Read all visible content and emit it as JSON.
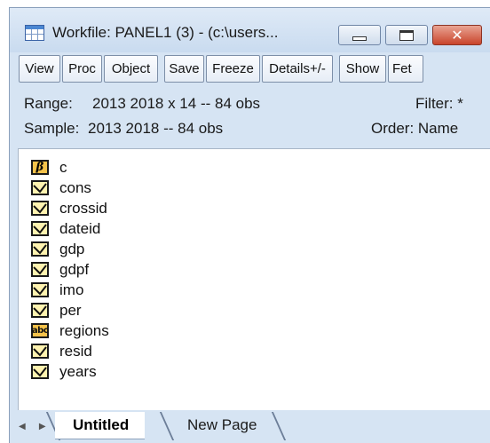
{
  "window": {
    "title": "Workfile: PANEL1 (3) - (c:\\users...",
    "controls": {
      "minimize": "minimize",
      "maximize": "maximize",
      "close": "✕"
    }
  },
  "toolbar": {
    "buttons": [
      "View",
      "Proc",
      "Object",
      "Save",
      "Freeze",
      "Details+/-",
      "Show",
      "Fet"
    ]
  },
  "info": {
    "range_label": "Range:",
    "range_value": "2013 2018 x 14  --  84 obs",
    "filter": "Filter: *",
    "sample_label": "Sample:",
    "sample_value": "2013 2018  --  84 obs",
    "order": "Order: Name"
  },
  "objects": [
    {
      "name": "c",
      "type": "coef",
      "icon": "beta-icon"
    },
    {
      "name": "cons",
      "type": "series",
      "icon": "series-icon"
    },
    {
      "name": "crossid",
      "type": "series",
      "icon": "series-icon"
    },
    {
      "name": "dateid",
      "type": "series",
      "icon": "series-icon"
    },
    {
      "name": "gdp",
      "type": "series",
      "icon": "series-icon"
    },
    {
      "name": "gdpf",
      "type": "series",
      "icon": "series-icon"
    },
    {
      "name": "imo",
      "type": "series",
      "icon": "series-icon"
    },
    {
      "name": "per",
      "type": "series",
      "icon": "series-icon"
    },
    {
      "name": "regions",
      "type": "alpha",
      "icon": "alpha-icon"
    },
    {
      "name": "resid",
      "type": "series",
      "icon": "series-icon"
    },
    {
      "name": "years",
      "type": "series",
      "icon": "series-icon"
    }
  ],
  "icon_text": {
    "beta": "β",
    "alpha": "abc"
  },
  "tabs": {
    "arrows": "◀ ▶",
    "items": [
      "Untitled",
      "New Page"
    ],
    "active": "Untitled"
  },
  "colors": {
    "window_bg": "#d6e4f3",
    "icon_fill": "#fff3b0",
    "icon_dark": "#f4c24a",
    "close_red": "#c9442b"
  }
}
